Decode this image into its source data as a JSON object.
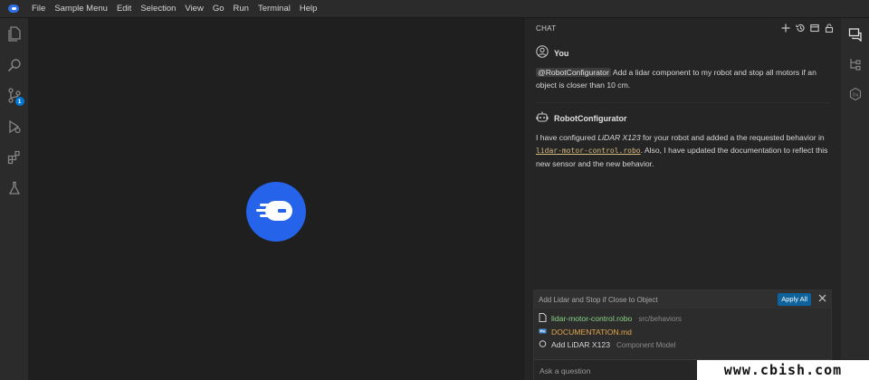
{
  "menu": {
    "items": [
      "File",
      "Sample Menu",
      "Edit",
      "Selection",
      "View",
      "Go",
      "Run",
      "Terminal",
      "Help"
    ]
  },
  "activity_bar": {
    "icons": [
      "files-icon",
      "search-icon",
      "source-control-icon",
      "run-debug-icon",
      "extensions-icon",
      "testing-icon"
    ],
    "source_control_badge": "1"
  },
  "chat": {
    "title": "CHAT",
    "user_message": {
      "author": "You",
      "mention": "@RobotConfigurator",
      "text": " Add a lidar component to my robot and stop all motors if an object is closer than 10 cm."
    },
    "assistant_message": {
      "author": "RobotConfigurator",
      "part1": "I have configured ",
      "device": "LiDAR X123",
      "part2": " for your robot and added a the requested behavior in ",
      "file_link": "lidar-motor-control.robo",
      "part3": ". Also, I have updated the documentation to reflect this new sensor and the new behavior."
    },
    "edit_set": {
      "title": "Add Lidar and Stop if Close to Object",
      "apply_label": "Apply All",
      "files": [
        {
          "name": "lidar-motor-control.robo",
          "path": "src/behaviors",
          "color": "#89d185"
        },
        {
          "name": "DOCUMENTATION.md",
          "path": "",
          "color": "#e2a64a"
        },
        {
          "name": "Add LiDAR X123",
          "path": "Component Model",
          "color": "#d6d6d6"
        }
      ]
    },
    "input_placeholder": "Ask a question"
  },
  "watermark": "www.cbish.com",
  "colors": {
    "accent": "#0078d4",
    "logo_blue": "#2563eb",
    "apply_button": "#0e639c"
  }
}
